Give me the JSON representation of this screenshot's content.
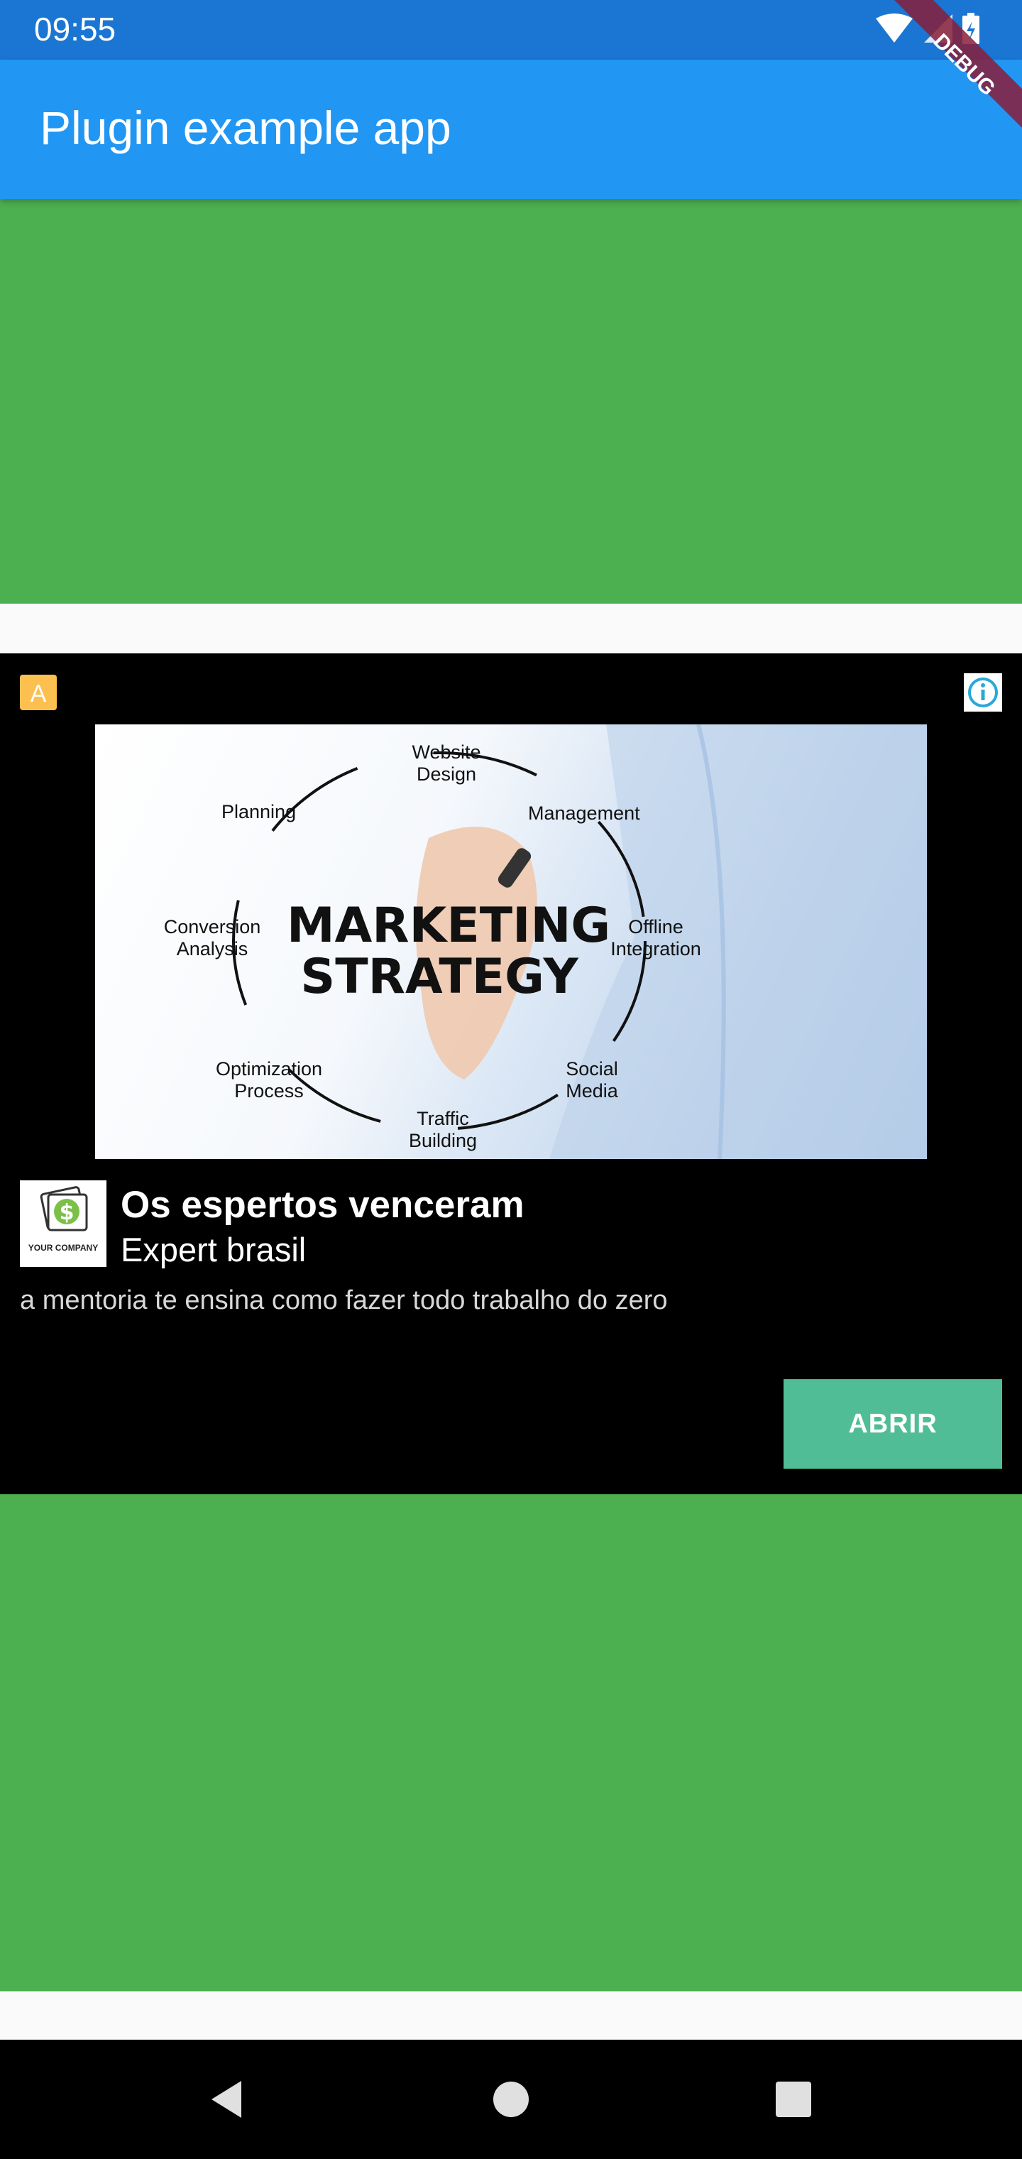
{
  "status_bar": {
    "time": "09:55"
  },
  "app_bar": {
    "title": "Plugin example app"
  },
  "debug_banner": {
    "label": "DEBUG"
  },
  "ad": {
    "badge": "A",
    "image_diagram": {
      "center": "MARKETING STRATEGY",
      "nodes": [
        "Website Design",
        "Management",
        "Offline Integration",
        "Social Media",
        "Traffic Building",
        "Optimization Process",
        "Conversion Analysis",
        "Planning"
      ]
    },
    "logo_text": "YOUR COMPANY",
    "headline": "Os espertos venceram",
    "advertiser": "Expert brasil",
    "body": "a mentoria te ensina como fazer todo trabalho do zero",
    "cta": "ABRIR"
  },
  "colors": {
    "status_bar": "#1a76d2",
    "app_bar": "#2196f3",
    "green": "#4caf50",
    "cta": "#50bd96"
  },
  "icons": [
    "wifi-icon",
    "cell-signal-icon",
    "battery-charging-icon",
    "ad-choices-info-icon",
    "nav-back-icon",
    "nav-home-icon",
    "nav-recents-icon"
  ]
}
